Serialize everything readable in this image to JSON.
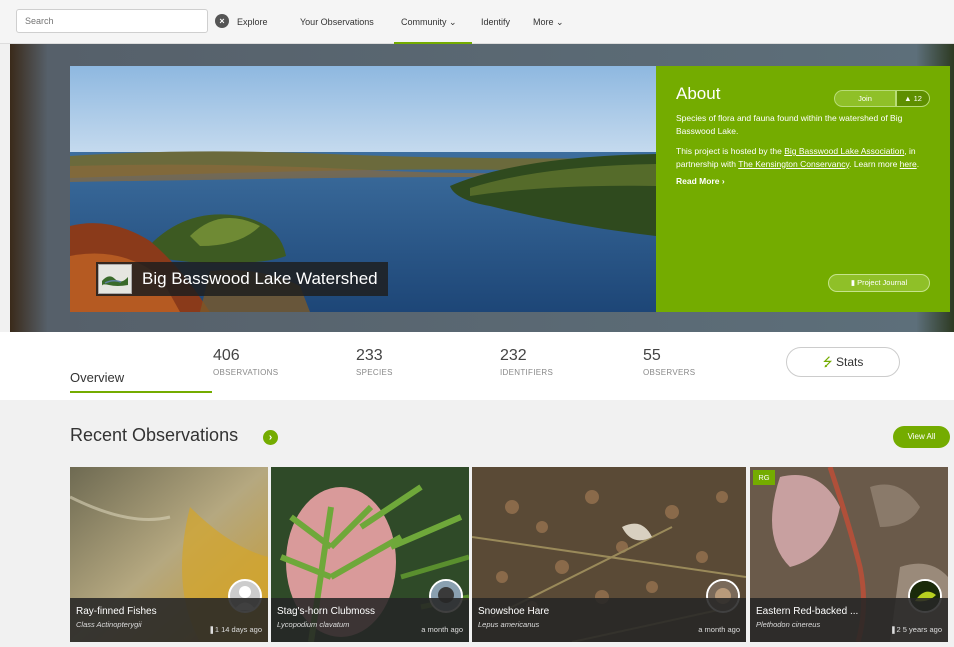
{
  "nav": {
    "search_placeholder": "Search",
    "clear_icon": "close-circle-icon",
    "items": [
      "Explore",
      "Your Observations",
      "Community ⌄",
      "Identify",
      "More ⌄"
    ],
    "active_index": 2,
    "accent": "#74ac00"
  },
  "project": {
    "title": "Big Basswood Lake Watershed",
    "about": {
      "heading": "About",
      "join_label": "Join",
      "members_count": "12",
      "description": "Species of flora and fauna found within the watershed of Big Basswood Lake.",
      "hosted_prefix": "This project is hosted by the ",
      "host_link": "Big Basswood Lake Association",
      "partner_text": ", in partnership with ",
      "partner_link": "The Kensington Conservancy",
      "learn_text": ". Learn more ",
      "here_link": "here",
      "period": ".",
      "read_more": "Read More ›",
      "journal_label": "Project Journal"
    }
  },
  "stats": {
    "overview_label": "Overview",
    "items": [
      {
        "num": "406",
        "label": "OBSERVATIONS"
      },
      {
        "num": "233",
        "label": "SPECIES"
      },
      {
        "num": "232",
        "label": "IDENTIFIERS"
      },
      {
        "num": "55",
        "label": "OBSERVERS"
      }
    ],
    "stats_button": "Stats"
  },
  "recent": {
    "title": "Recent Observations",
    "view_all": "View All",
    "observations": [
      {
        "name": "Ray-finned Fishes",
        "sci": "Class Actinopterygii",
        "meta": "❚1 14 days ago",
        "rg": ""
      },
      {
        "name": "Stag's-horn Clubmoss",
        "sci": "Lycopodium clavatum",
        "meta": "a month ago",
        "rg": ""
      },
      {
        "name": "Snowshoe Hare",
        "sci": "Lepus americanus",
        "meta": "a month ago",
        "rg": ""
      },
      {
        "name": "Eastern Red-backed ...",
        "sci": "Plethodon cinereus",
        "meta": "❚2 5 years ago",
        "rg": "RG"
      }
    ]
  }
}
